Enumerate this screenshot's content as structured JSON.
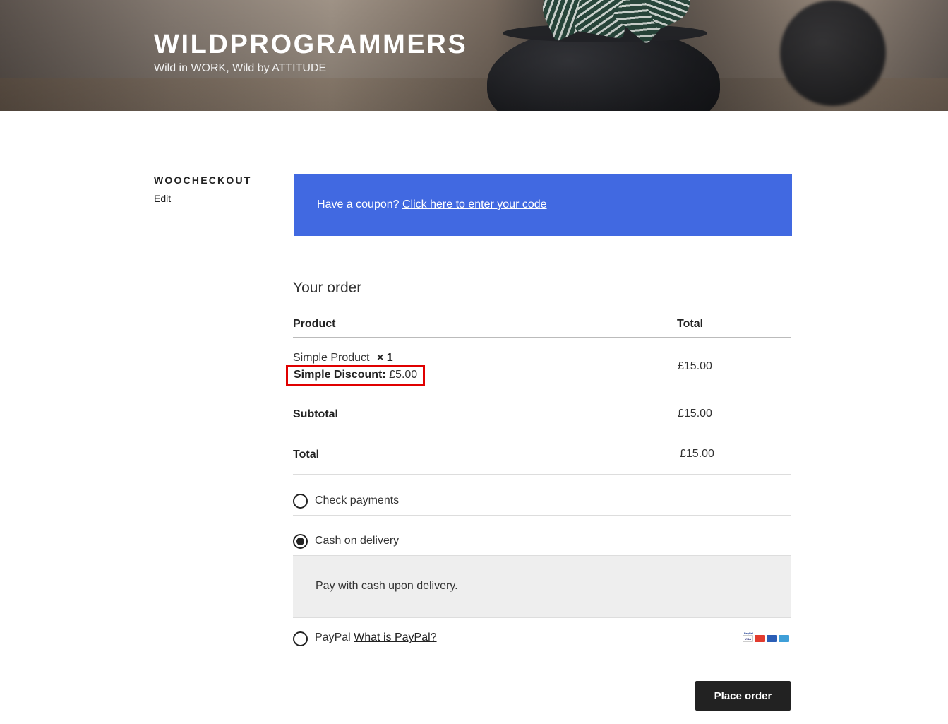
{
  "header": {
    "site_title": "WILDPROGRAMMERS",
    "tagline": "Wild in WORK, Wild by ATTITUDE"
  },
  "page": {
    "title": "WOOCHECKOUT",
    "edit_label": "Edit"
  },
  "coupon": {
    "prompt": "Have a coupon?",
    "link_text": "Click here to enter your code",
    "background_color": "#4169e1"
  },
  "order": {
    "heading": "Your order",
    "columns": {
      "product": "Product",
      "total": "Total"
    },
    "item": {
      "name": "Simple Product",
      "quantity": "× 1",
      "discount_label": "Simple Discount:",
      "discount_value": "£5.00",
      "total": "£15.00"
    },
    "subtotal": {
      "label": "Subtotal",
      "value": "£15.00"
    },
    "total": {
      "label": "Total",
      "value": "£15.00"
    }
  },
  "payment": {
    "methods": [
      {
        "label": "Check payments",
        "selected": false
      },
      {
        "label": "Cash on delivery",
        "selected": true,
        "description": "Pay with cash upon delivery."
      },
      {
        "label": "PayPal",
        "link_text": "What is PayPal?",
        "selected": false
      }
    ],
    "card_icons": [
      "paypal-icon",
      "visa-icon",
      "mastercard-icon",
      "maestro-icon",
      "amex-icon"
    ],
    "paypal_logo_text": "PayPal",
    "visa_text": "VISA"
  },
  "actions": {
    "place_order_label": "Place order"
  },
  "colors": {
    "highlight_border": "#e00000",
    "button_bg": "#222222"
  }
}
